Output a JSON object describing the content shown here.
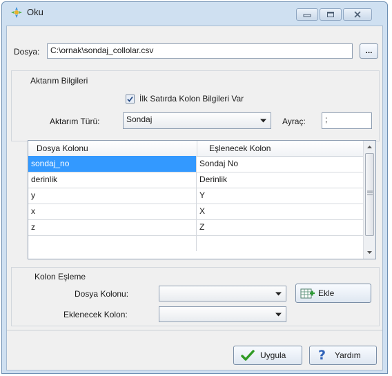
{
  "window": {
    "title": "Oku"
  },
  "file": {
    "label": "Dosya:",
    "path": "C:\\ornak\\sondaj_collolar.csv",
    "browse_label": "..."
  },
  "transfer": {
    "group_label": "Aktarım Bilgileri",
    "header_checkbox_label": "İlk Satırda Kolon Bilgileri Var",
    "header_checkbox_checked": true,
    "type_label": "Aktarım Türü:",
    "type_value": "Sondaj",
    "separator_label": "Ayraç:",
    "separator_value": ";"
  },
  "mapping_table": {
    "columns": [
      "Dosya Kolonu",
      "Eşlenecek Kolon"
    ],
    "rows": [
      [
        "sondaj_no",
        "Sondaj No"
      ],
      [
        "derinlik",
        "Derinlik"
      ],
      [
        "y",
        "Y"
      ],
      [
        "x",
        "X"
      ],
      [
        "z",
        "Z"
      ]
    ],
    "selected_row": 0
  },
  "column_mapping": {
    "group_label": "Kolon Eşleme",
    "file_column_label": "Dosya Kolonu:",
    "file_column_value": "",
    "add_label": "Ekle",
    "target_column_label": "Eklenecek Kolon:",
    "target_column_value": ""
  },
  "footer": {
    "apply_label": "Uygula",
    "help_label": "Yardım"
  },
  "colors": {
    "selection": "#3399ff",
    "window_frame": "#cfe0f1",
    "dialog_bg": "#f0f0f0"
  }
}
